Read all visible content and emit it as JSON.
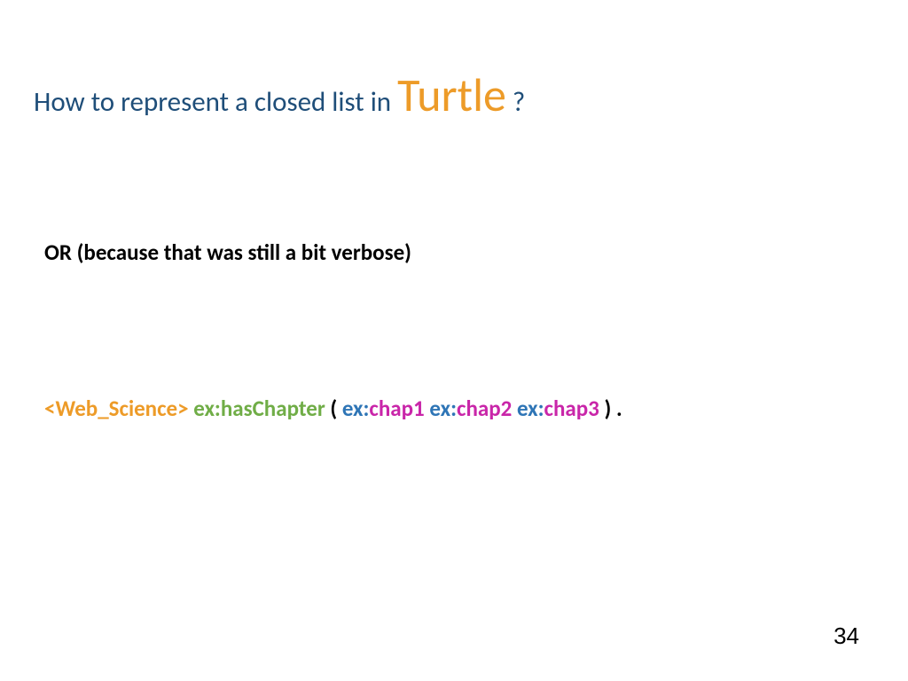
{
  "title": {
    "part1": "How to represent a closed list in ",
    "emphasis": "Turtle",
    "part2": " ?"
  },
  "subtitle": "OR (because that was still a bit verbose)",
  "code": {
    "subject": "<Web_Science>",
    "predicate_prefix": "ex:",
    "predicate_name": "hasChapter",
    "open_paren": "(",
    "obj1_prefix": "ex:",
    "obj1_name": "chap1",
    "obj2_prefix": "ex:",
    "obj2_name": "chap2",
    "obj3_prefix": "ex:",
    "obj3_name": "chap3",
    "close_paren": ")",
    "terminator": "."
  },
  "page_number": "34"
}
